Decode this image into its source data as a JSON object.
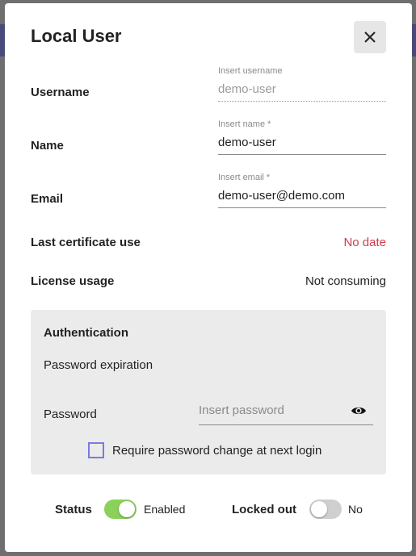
{
  "modal": {
    "title": "Local User",
    "close_icon": "close-icon"
  },
  "fields": {
    "username": {
      "label": "Username",
      "hint": "Insert username",
      "value": "demo-user"
    },
    "name": {
      "label": "Name",
      "hint": "Insert name *",
      "value": "demo-user"
    },
    "email": {
      "label": "Email",
      "hint": "Insert email *",
      "value": "demo-user@demo.com"
    }
  },
  "info": {
    "last_cert_label": "Last certificate use",
    "last_cert_value": "No date",
    "license_label": "License usage",
    "license_value": "Not consuming"
  },
  "auth": {
    "title": "Authentication",
    "pw_expiration_label": "Password expiration",
    "password_label": "Password",
    "password_placeholder": "Insert password",
    "require_change_label": "Require password change at next login",
    "eye_icon": "eye-icon"
  },
  "status": {
    "status_label": "Status",
    "status_value": "Enabled",
    "locked_label": "Locked out",
    "locked_value": "No"
  },
  "colors": {
    "accent_red": "#d33a4a",
    "toggle_on": "#8bd05a",
    "toggle_off": "#cfcfcf",
    "checkbox_border": "#7b7bdc"
  }
}
